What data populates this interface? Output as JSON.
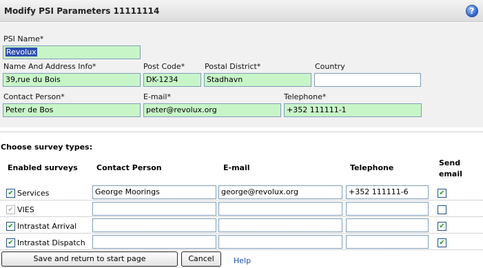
{
  "header": {
    "title": "Modify PSI Parameters 11111114",
    "help_glyph": "?"
  },
  "form": {
    "psi_name": {
      "label": "PSI Name*",
      "value": "Revolux"
    },
    "address": {
      "label": "Name And Address Info*",
      "value": "39,rue du Bois"
    },
    "post_code": {
      "label": "Post Code*",
      "value": "DK-1234"
    },
    "postal_district": {
      "label": "Postal District*",
      "value": "Stadhavn"
    },
    "country": {
      "label": "Country",
      "value": ""
    },
    "contact_person": {
      "label": "Contact Person*",
      "value": "Peter de Bos"
    },
    "email": {
      "label": "E-mail*",
      "value": "peter@revolux.org"
    },
    "telephone": {
      "label": "Telephone*",
      "value": "+352 111111-1"
    }
  },
  "survey": {
    "title": "Choose survey types:",
    "columns": [
      "Enabled surveys",
      "Contact Person",
      "E-mail",
      "Telephone",
      "Send",
      "email"
    ],
    "rows": [
      {
        "label": "Services",
        "enabled": true,
        "disabled": false,
        "contact": "George Moorings",
        "email": "george@revolux.org",
        "telephone": "+352 111111-6",
        "send_email": true
      },
      {
        "label": "VIES",
        "enabled": true,
        "disabled": true,
        "contact": "",
        "email": "",
        "telephone": "",
        "send_email": false
      },
      {
        "label": "Intrastat Arrival",
        "enabled": true,
        "disabled": false,
        "contact": "",
        "email": "",
        "telephone": "",
        "send_email": true
      },
      {
        "label": "Intrastat Dispatch",
        "enabled": true,
        "disabled": false,
        "contact": "",
        "email": "",
        "telephone": "",
        "send_email": true
      }
    ]
  },
  "actions": {
    "save": "Save and return to start page",
    "cancel": "Cancel",
    "help": "Help"
  }
}
